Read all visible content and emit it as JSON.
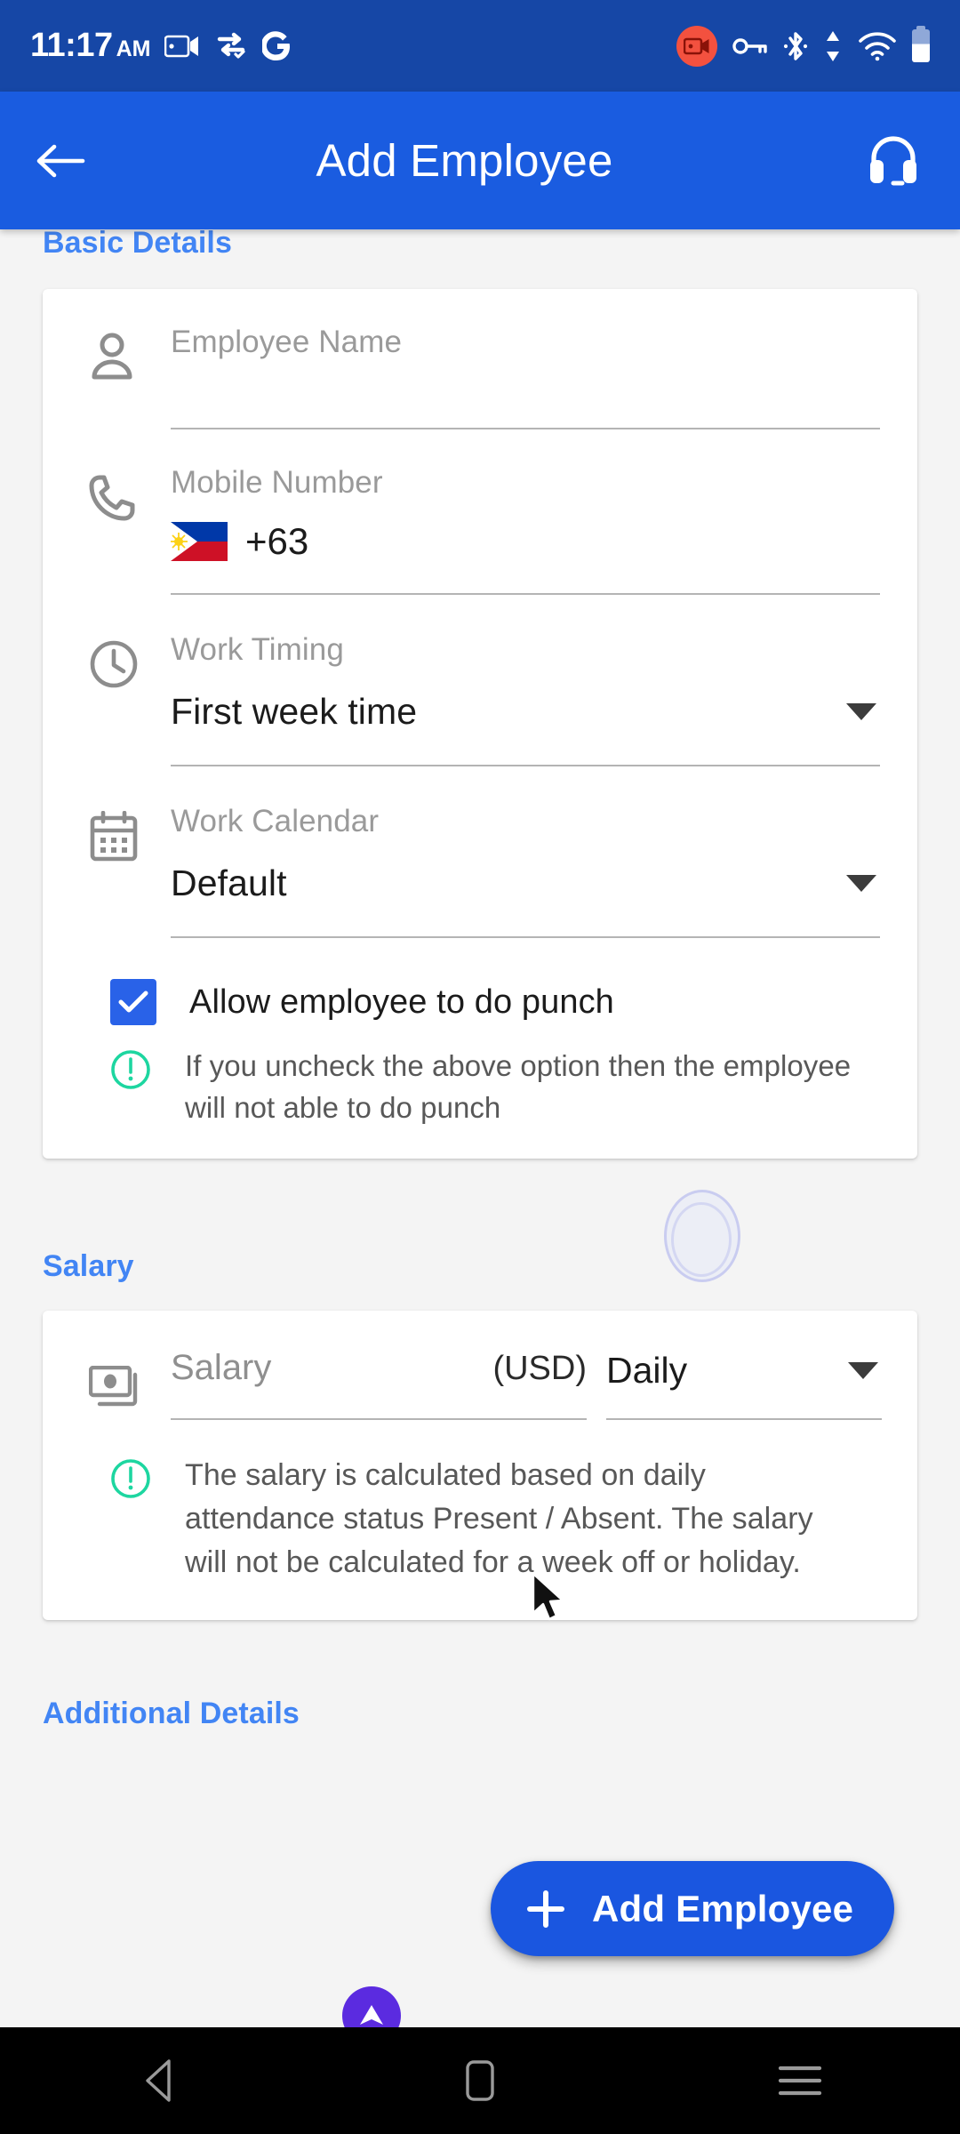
{
  "status_bar": {
    "time": "11:17",
    "ampm": "AM",
    "icons_left": [
      "screen-cast-icon",
      "vpn-sync-icon",
      "google-icon"
    ],
    "icons_right": [
      "screen-record-icon",
      "vpn-key-icon",
      "bluetooth-icon",
      "data-transfer-icon",
      "wifi-icon",
      "battery-icon"
    ]
  },
  "app_bar": {
    "back_label": "",
    "title": "Add Employee",
    "support_label": ""
  },
  "basic_details": {
    "heading": "Basic Details",
    "employee_name": {
      "label": "Employee Name",
      "value": ""
    },
    "mobile_number": {
      "label": "Mobile Number",
      "country_code": "+63",
      "flag": "philippines-flag",
      "value": ""
    },
    "work_timing": {
      "label": "Work Timing",
      "value": "First week time"
    },
    "work_calendar": {
      "label": "Work Calendar",
      "value": "Default"
    },
    "punch_checkbox": {
      "label": "Allow employee to do punch",
      "checked": true
    },
    "punch_info": "If you uncheck the above option then the employee will not able to do punch"
  },
  "salary": {
    "heading": "Salary",
    "amount": {
      "placeholder": "Salary",
      "currency": "(USD)",
      "value": ""
    },
    "period": {
      "value": "Daily"
    },
    "info": "The salary is calculated based on daily attendance status Present / Absent. The salary will not be calculated for a week off or holiday."
  },
  "additional_details": {
    "heading": "Additional Details"
  },
  "fab": {
    "label": "Add Employee",
    "icon": "plus-icon"
  },
  "nav_bar": {
    "back": "back-triangle-icon",
    "home": "home-square-icon",
    "recents": "recents-menu-icon"
  },
  "colors": {
    "status_bar": "#1647A6",
    "app_bar": "#1A5CE0",
    "accent_blue": "#4285F4",
    "checkbox_blue": "#2962E8",
    "fab_blue": "#1A56E0",
    "info_green": "#1DD6A0",
    "page_bg": "#f4f4f4",
    "purple_badge": "#5B2BE0"
  }
}
